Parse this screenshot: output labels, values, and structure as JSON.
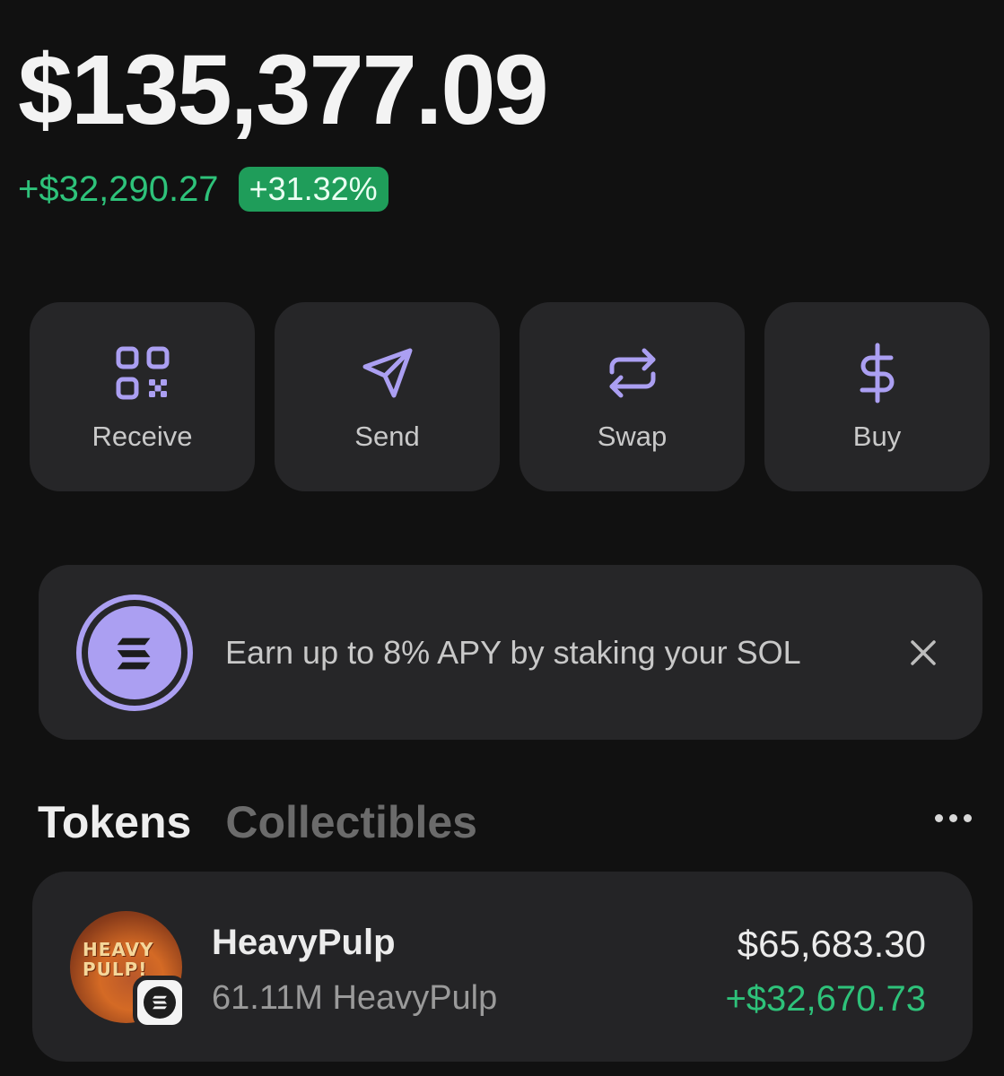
{
  "balance": {
    "total": "$135,377.09",
    "change_amount": "+$32,290.27",
    "change_percent": "+31.32%"
  },
  "actions": [
    {
      "label": "Receive",
      "icon": "qr-code-icon"
    },
    {
      "label": "Send",
      "icon": "send-icon"
    },
    {
      "label": "Swap",
      "icon": "swap-icon"
    },
    {
      "label": "Buy",
      "icon": "dollar-icon"
    }
  ],
  "banner": {
    "text": "Earn up to 8% APY by staking your SOL",
    "icon": "solana-icon"
  },
  "tabs": [
    {
      "label": "Tokens",
      "active": true
    },
    {
      "label": "Collectibles",
      "active": false
    }
  ],
  "tokens": [
    {
      "name": "HeavyPulp",
      "amount": "61.11M HeavyPulp",
      "value": "$65,683.30",
      "change": "+$32,670.73",
      "avatar_text": "HEAVY PULP!"
    }
  ],
  "colors": {
    "accent": "#ab9ff2",
    "positive": "#2ec27a",
    "background": "#111111",
    "card": "#262628"
  }
}
